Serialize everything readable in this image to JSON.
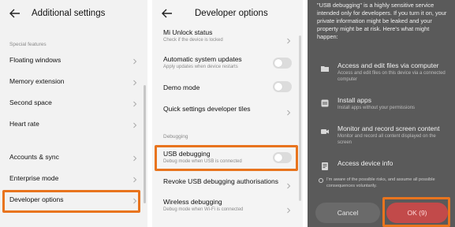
{
  "colors": {
    "highlight": "#e8741e",
    "ok_button": "#c24a4a",
    "dialog_bg": "#5a5a5a"
  },
  "panel1": {
    "title": "Additional settings",
    "section_label": "Special features",
    "items": [
      {
        "label": "Floating windows"
      },
      {
        "label": "Memory extension"
      },
      {
        "label": "Second space"
      },
      {
        "label": "Heart rate"
      },
      {
        "label": "Accounts & sync"
      },
      {
        "label": "Enterprise mode"
      },
      {
        "label": "Developer options"
      }
    ]
  },
  "panel2": {
    "title": "Developer options",
    "items": [
      {
        "label": "Mi Unlock status",
        "sub": "Check if the device is locked",
        "control": "chevron"
      },
      {
        "label": "Automatic system updates",
        "sub": "Apply updates when device restarts",
        "control": "toggle"
      },
      {
        "label": "Demo mode",
        "sub": "",
        "control": "toggle"
      },
      {
        "label": "Quick settings developer tiles",
        "sub": "",
        "control": "chevron"
      }
    ],
    "section_label": "Debugging",
    "debug_items": [
      {
        "label": "USB debugging",
        "sub": "Debug mode when USB is connected",
        "control": "toggle"
      },
      {
        "label": "Revoke USB debugging authorisations",
        "sub": "",
        "control": "chevron"
      },
      {
        "label": "Wireless debugging",
        "sub": "Debug mode when Wi-Fi is connected",
        "control": "chevron"
      }
    ]
  },
  "panel3": {
    "warning": "\"USB debugging\" is a highly sensitive service intended only for developers. If you turn it on, your private information might be leaked and your property might be at risk. Here's what might happen:",
    "permissions": [
      {
        "icon": "folder-icon",
        "title": "Access and edit files via computer",
        "sub": "Access and edit files on this device via a connected computer"
      },
      {
        "icon": "install-icon",
        "title": "Install apps",
        "sub": "Install apps without your permissions"
      },
      {
        "icon": "screen-record-icon",
        "title": "Monitor and record screen content",
        "sub": "Monitor and record all content displayed on the screen"
      },
      {
        "icon": "device-info-icon",
        "title": "Access device info",
        "sub": ""
      }
    ],
    "risk_text": "I'm aware of the possible risks, and assume all possible consequences voluntarily.",
    "cancel_label": "Cancel",
    "ok_label": "OK (9)"
  }
}
